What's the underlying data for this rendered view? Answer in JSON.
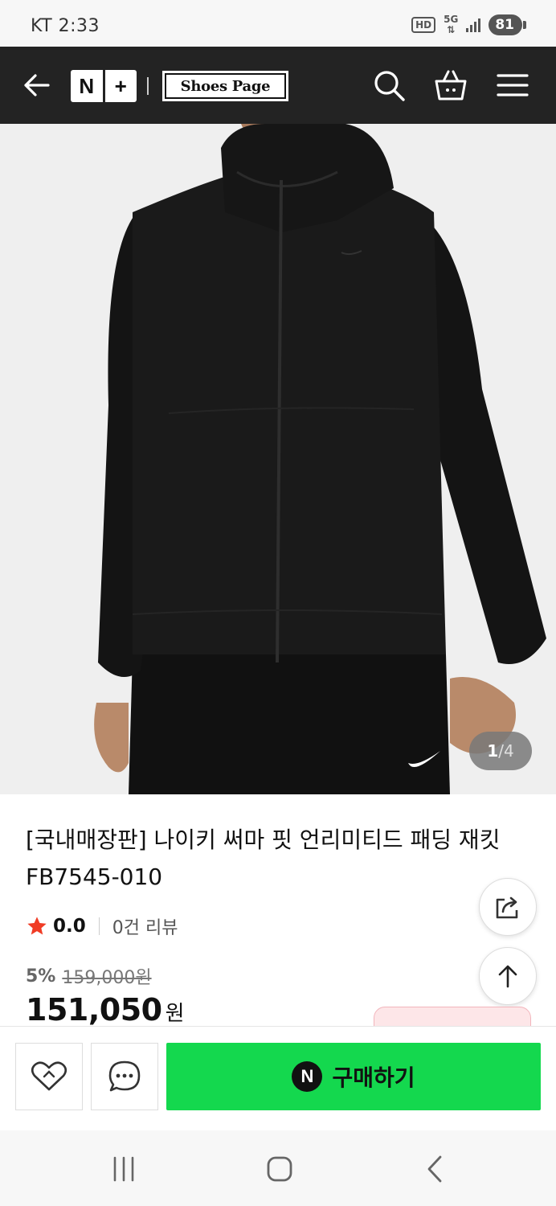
{
  "status_bar": {
    "carrier_time": "KT 2:33",
    "hd": "HD",
    "network": "5G",
    "battery": "81"
  },
  "header": {
    "logo_n": "N",
    "logo_plus": "+",
    "brand": "Shoes Page"
  },
  "image": {
    "current": "1",
    "separator": " / ",
    "total": "4"
  },
  "product": {
    "title": "[국내매장판] 나이키 써마 핏 언리미티드 패딩 재킷 FB7545-010",
    "rating": "0.0",
    "reviews": "0건 리뷰",
    "discount": "5%",
    "original_price": "159,000원",
    "price": "151,050",
    "currency": "원"
  },
  "bottom_bar": {
    "buy_icon": "N",
    "buy_label": "구매하기"
  },
  "colors": {
    "header_bg": "#232323",
    "buy_green": "#14d84e",
    "star_red": "#f03c25"
  },
  "icons": [
    "back-arrow-icon",
    "search-icon",
    "cart-icon",
    "menu-icon",
    "share-icon",
    "arrow-up-icon",
    "heart-icon",
    "chat-icon",
    "recent-apps-icon",
    "home-icon",
    "nav-back-icon"
  ]
}
